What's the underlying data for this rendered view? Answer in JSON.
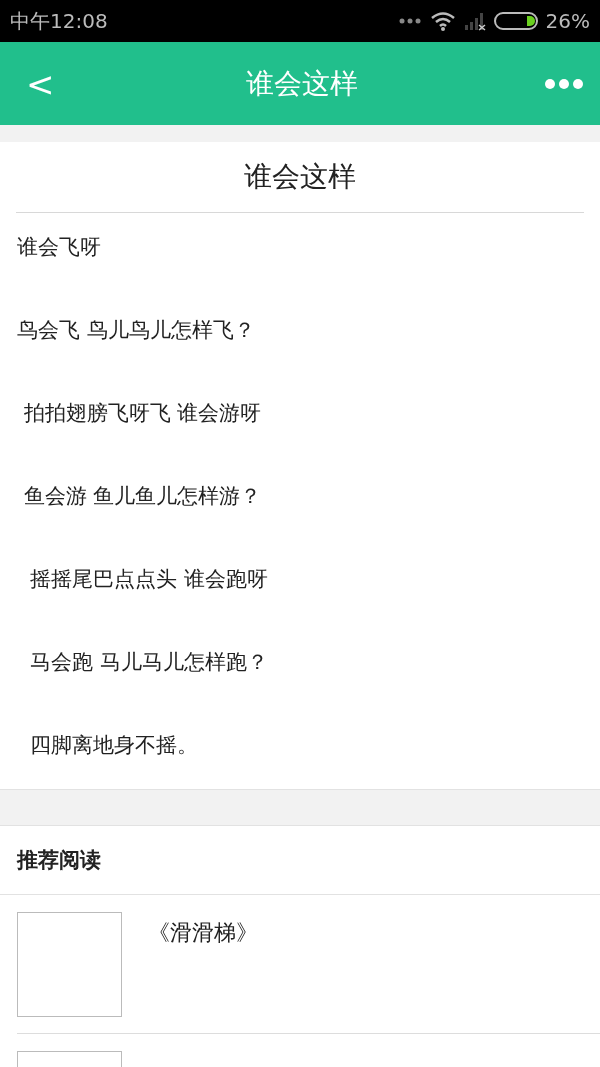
{
  "status_bar": {
    "time": "中午12:08",
    "battery": "26%"
  },
  "header": {
    "back": "<",
    "title": "谁会这样"
  },
  "article": {
    "title": "谁会这样",
    "lines": [
      "谁会飞呀",
      "鸟会飞 鸟儿鸟儿怎样飞？",
      " 拍拍翅膀飞呀飞 谁会游呀",
      " 鱼会游 鱼儿鱼儿怎样游？",
      "  摇摇尾巴点点头 谁会跑呀",
      "  马会跑 马儿马儿怎样跑？",
      "  四脚离地身不摇。"
    ]
  },
  "recommended": {
    "heading": "推荐阅读",
    "items": [
      {
        "kind": "article",
        "title": "《滑滑梯》"
      },
      {
        "kind": "cut_off"
      }
    ]
  }
}
